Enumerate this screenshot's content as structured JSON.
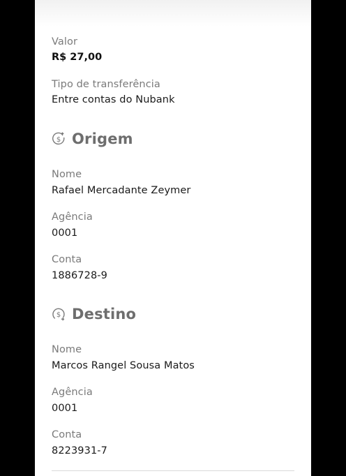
{
  "valor": {
    "label": "Valor",
    "value": "R$ 27,00"
  },
  "tipo": {
    "label": "Tipo de transferência",
    "value": "Entre contas do Nubank"
  },
  "origem": {
    "title": "Origem",
    "icon": "money-out-icon",
    "nome": {
      "label": "Nome",
      "value": "Rafael Mercadante Zeymer"
    },
    "agencia": {
      "label": "Agência",
      "value": "0001"
    },
    "conta": {
      "label": "Conta",
      "value": "1886728-9"
    }
  },
  "destino": {
    "title": "Destino",
    "icon": "money-in-icon",
    "nome": {
      "label": "Nome",
      "value": "Marcos Rangel Sousa Matos"
    },
    "agencia": {
      "label": "Agência",
      "value": "0001"
    },
    "conta": {
      "label": "Conta",
      "value": "8223931-7"
    }
  }
}
